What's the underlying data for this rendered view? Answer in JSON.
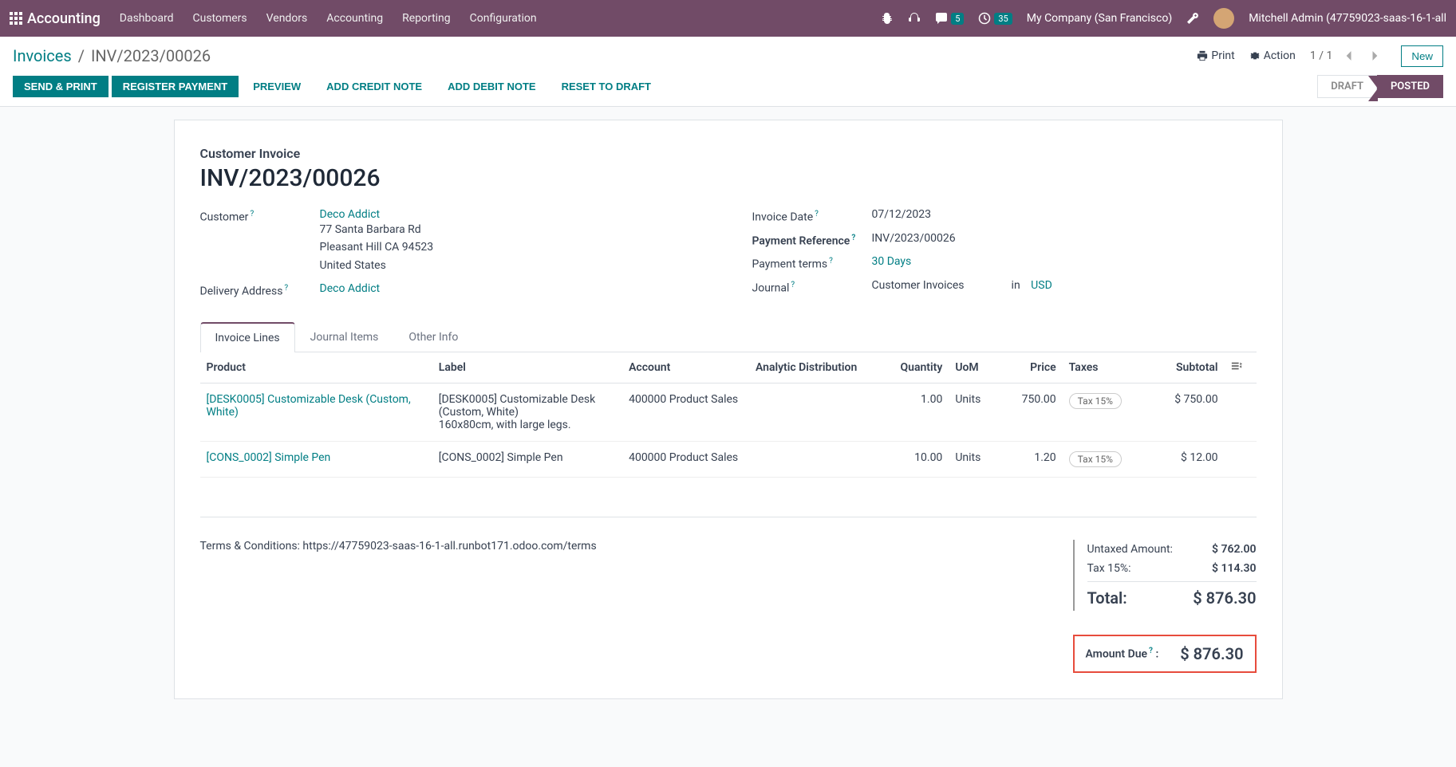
{
  "navbar": {
    "brand": "Accounting",
    "menu": [
      "Dashboard",
      "Customers",
      "Vendors",
      "Accounting",
      "Reporting",
      "Configuration"
    ],
    "msg_count": "5",
    "activity_count": "35",
    "company": "My Company (San Francisco)",
    "user": "Mitchell Admin (47759023-saas-16-1-all"
  },
  "breadcrumb": {
    "parent": "Invoices",
    "current": "INV/2023/00026"
  },
  "cp": {
    "print": "Print",
    "action": "Action",
    "pager": "1 / 1",
    "new": "New"
  },
  "buttons": {
    "send_print": "SEND & PRINT",
    "register_payment": "REGISTER PAYMENT",
    "preview": "PREVIEW",
    "credit_note": "ADD CREDIT NOTE",
    "debit_note": "ADD DEBIT NOTE",
    "reset": "RESET TO DRAFT"
  },
  "status": {
    "draft": "DRAFT",
    "posted": "POSTED"
  },
  "doc": {
    "type": "Customer Invoice",
    "name": "INV/2023/00026"
  },
  "labels": {
    "customer": "Customer",
    "delivery": "Delivery Address",
    "invoice_date": "Invoice Date",
    "payment_ref": "Payment Reference",
    "payment_terms": "Payment terms",
    "journal": "Journal",
    "in": "in"
  },
  "fields": {
    "customer": "Deco Addict",
    "addr1": "77 Santa Barbara Rd",
    "addr2": "Pleasant Hill CA 94523",
    "addr3": "United States",
    "delivery": "Deco Addict",
    "invoice_date": "07/12/2023",
    "payment_ref": "INV/2023/00026",
    "payment_terms": "30 Days",
    "journal": "Customer Invoices",
    "currency": "USD"
  },
  "tabs": {
    "lines": "Invoice Lines",
    "journal": "Journal Items",
    "other": "Other Info"
  },
  "table": {
    "headers": {
      "product": "Product",
      "label": "Label",
      "account": "Account",
      "analytic": "Analytic Distribution",
      "quantity": "Quantity",
      "uom": "UoM",
      "price": "Price",
      "taxes": "Taxes",
      "subtotal": "Subtotal"
    },
    "rows": [
      {
        "product": "[DESK0005] Customizable Desk (Custom, White)",
        "label": "[DESK0005] Customizable Desk (Custom, White)\n160x80cm, with large legs.",
        "account": "400000 Product Sales",
        "quantity": "1.00",
        "uom": "Units",
        "price": "750.00",
        "tax": "Tax 15%",
        "subtotal": "$ 750.00"
      },
      {
        "product": "[CONS_0002] Simple Pen",
        "label": "[CONS_0002] Simple Pen",
        "account": "400000 Product Sales",
        "quantity": "10.00",
        "uom": "Units",
        "price": "1.20",
        "tax": "Tax 15%",
        "subtotal": "$ 12.00"
      }
    ]
  },
  "terms": "Terms & Conditions: https://47759023-saas-16-1-all.runbot171.odoo.com/terms",
  "totals": {
    "untaxed_label": "Untaxed Amount:",
    "untaxed": "$ 762.00",
    "tax_label": "Tax 15%:",
    "tax": "$ 114.30",
    "total_label": "Total:",
    "total": "$ 876.30",
    "due_label": "Amount Due",
    "due": "$ 876.30"
  }
}
